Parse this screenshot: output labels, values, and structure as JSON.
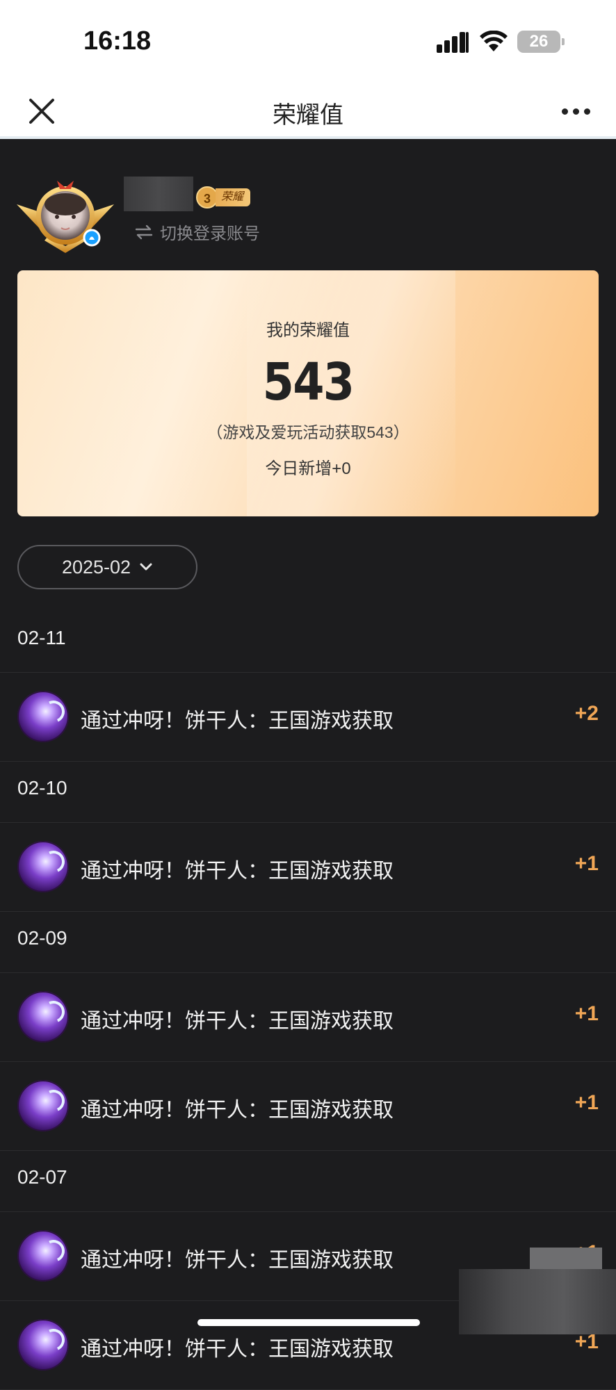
{
  "status_bar": {
    "time": "16:18",
    "battery": "26"
  },
  "nav": {
    "title": "荣耀值"
  },
  "profile": {
    "level": "3",
    "level_label": "荣耀",
    "switch_account": "切换登录账号"
  },
  "summary_card": {
    "label": "我的荣耀值",
    "value": "543",
    "note": "（游戏及爱玩活动获取543）",
    "today": "今日新增+0"
  },
  "month_filter": {
    "value": "2025-02"
  },
  "records": [
    {
      "date": "02-11",
      "items": [
        {
          "text": "通过冲呀！饼干人：王国游戏获取",
          "points": "+2"
        }
      ]
    },
    {
      "date": "02-10",
      "items": [
        {
          "text": "通过冲呀！饼干人：王国游戏获取",
          "points": "+1"
        }
      ]
    },
    {
      "date": "02-09",
      "items": [
        {
          "text": "通过冲呀！饼干人：王国游戏获取",
          "points": "+1"
        },
        {
          "text": "通过冲呀！饼干人：王国游戏获取",
          "points": "+1"
        }
      ]
    },
    {
      "date": "02-07",
      "items": [
        {
          "text": "通过冲呀！饼干人：王国游戏获取",
          "points": "+1"
        },
        {
          "text": "通过冲呀！饼干人：王国游戏获取",
          "points": "+1"
        }
      ]
    }
  ],
  "colors": {
    "accent_points": "#f0a656",
    "background": "#1c1c1e",
    "card_gradient_start": "#fde6c6",
    "card_gradient_end": "#fbc17d"
  },
  "icons": {
    "close": "close-icon",
    "more": "more-icon",
    "switch": "swap-arrows-icon",
    "dropdown": "chevron-down-icon",
    "record": "game-orb-icon"
  }
}
